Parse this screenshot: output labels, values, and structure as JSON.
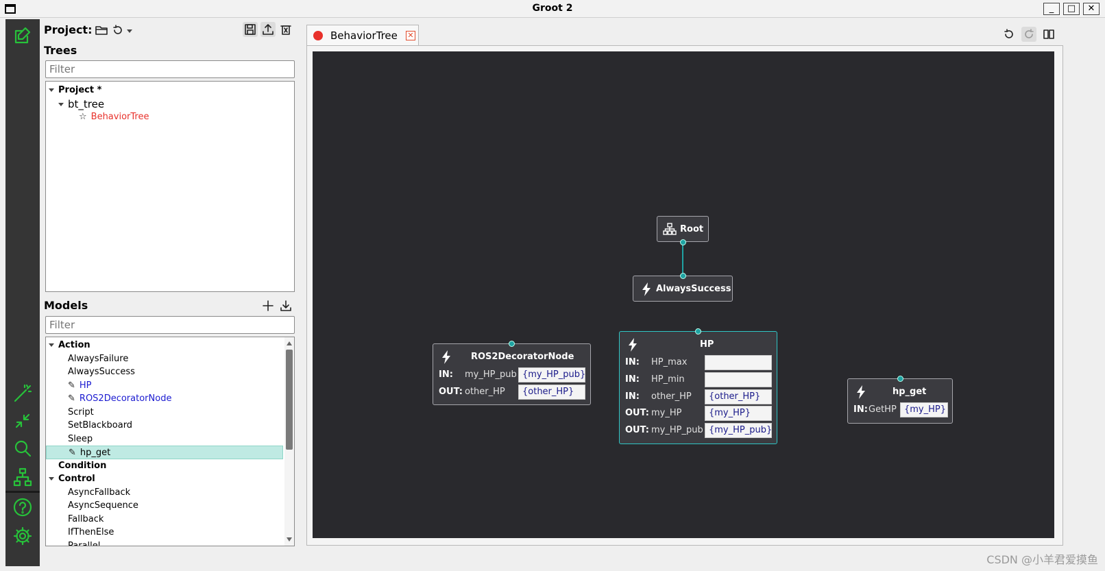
{
  "window": {
    "title": "Groot 2"
  },
  "side": {
    "project_label": "Project:",
    "trees_heading": "Trees",
    "trees_filter_placeholder": "Filter",
    "tree": {
      "root": "Project *",
      "file": "bt_tree",
      "item": "BehaviorTree"
    },
    "models_heading": "Models",
    "models_filter_placeholder": "Filter",
    "models": {
      "action_group": "Action",
      "action_items": [
        "AlwaysFailure",
        "AlwaysSuccess",
        "HP",
        "ROS2DecoratorNode",
        "Script",
        "SetBlackboard",
        "Sleep",
        "hp_get"
      ],
      "condition_group": "Condition",
      "control_group": "Control",
      "control_items": [
        "AsyncFallback",
        "AsyncSequence",
        "Fallback",
        "IfThenElse",
        "Parallel"
      ]
    }
  },
  "tab": {
    "label": "BehaviorTree"
  },
  "canvas": {
    "root_node": "Root",
    "always_success_node": "AlwaysSuccess",
    "ros2_node": {
      "title": "ROS2DecoratorNode",
      "ports": [
        {
          "dir": "IN:",
          "name": "my_HP_pub",
          "value": "{my_HP_pub}"
        },
        {
          "dir": "OUT:",
          "name": "other_HP",
          "value": "{other_HP}"
        }
      ]
    },
    "hp_node": {
      "title": "HP",
      "ports": [
        {
          "dir": "IN:",
          "name": "HP_max",
          "value": ""
        },
        {
          "dir": "IN:",
          "name": "HP_min",
          "value": ""
        },
        {
          "dir": "IN:",
          "name": "other_HP",
          "value": "{other_HP}"
        },
        {
          "dir": "OUT:",
          "name": "my_HP",
          "value": "{my_HP}"
        },
        {
          "dir": "OUT:",
          "name": "my_HP_pub",
          "value": "{my_HP_pub}"
        }
      ]
    },
    "hp_get_node": {
      "title": "hp_get",
      "ports": [
        {
          "dir": "IN:",
          "name": "GetHP",
          "value": "{my_HP}"
        }
      ]
    }
  },
  "watermark": "CSDN @小羊君爱摸鱼",
  "colors": {
    "accent_green": "#27c23a",
    "canvas_bg": "#29292d",
    "link": "#1fa3a3",
    "selected_row": "#bfeae3",
    "red_item": "#e8312b",
    "blue_item": "#1a1ad0"
  }
}
